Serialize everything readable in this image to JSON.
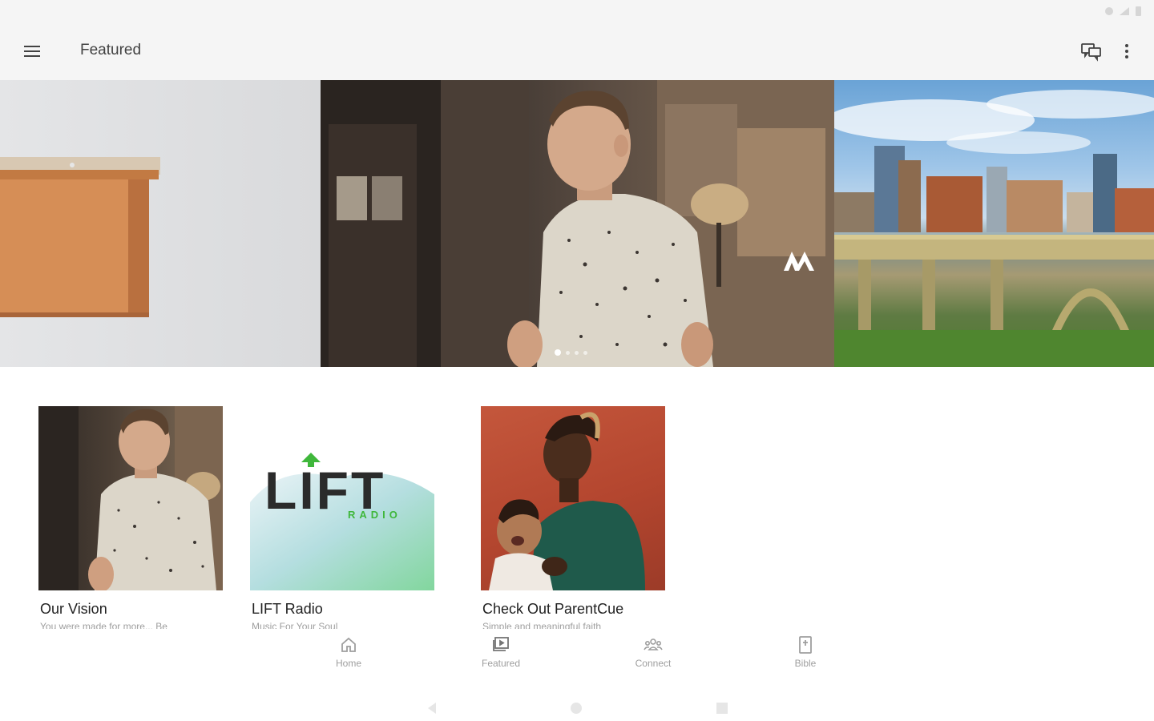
{
  "app_bar": {
    "title": "Featured"
  },
  "carousel": {
    "slide_count": 4,
    "active_index": 0
  },
  "cards": [
    {
      "title": "Our Vision",
      "subtitle": "You were made for more... Be"
    },
    {
      "title": "LIFT Radio",
      "subtitle": "Music For Your Soul",
      "logo_word": "LIFT",
      "logo_sub": "RADIO"
    },
    {
      "title": "Check Out ParentCue",
      "subtitle": "Simple and meaningful faith"
    }
  ],
  "bottom_nav": {
    "items": [
      {
        "label": "Home",
        "icon": "home-icon"
      },
      {
        "label": "Featured",
        "icon": "featured-icon"
      },
      {
        "label": "Connect",
        "icon": "connect-icon"
      },
      {
        "label": "Bible",
        "icon": "bible-icon"
      }
    ]
  },
  "colors": {
    "app_bar_bg": "#f5f5f5",
    "accent_green": "#3fb73b",
    "text_primary": "#212121",
    "text_secondary": "#9e9e9e"
  }
}
